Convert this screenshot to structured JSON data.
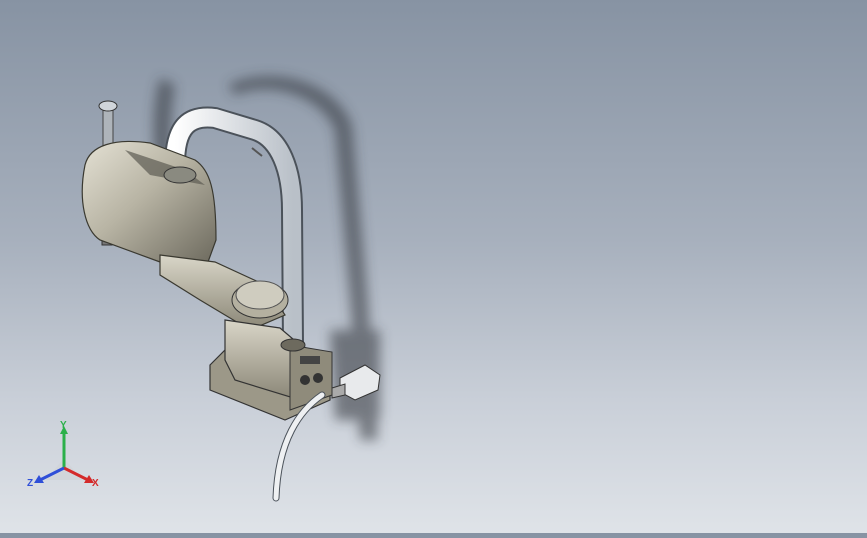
{
  "scene": {
    "subject": "scara-robot-arm-model",
    "background_top": "#8793a3",
    "background_bottom": "#dfe3e8",
    "body_color": "#c3bfb0",
    "cable_color": "#e9ecef"
  },
  "triad": {
    "x_label": "X",
    "y_label": "Y",
    "z_label": "Z",
    "x_color": "#d42a2a",
    "y_color": "#2bb04a",
    "z_color": "#2f4fd8"
  }
}
